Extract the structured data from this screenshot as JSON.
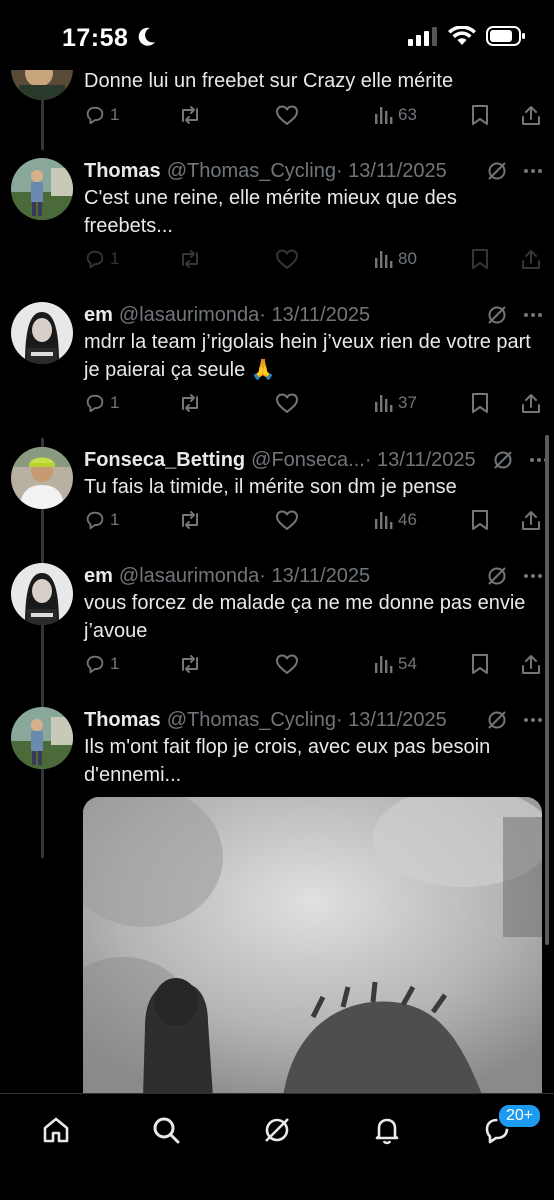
{
  "status_bar": {
    "time": "17:58"
  },
  "partial_tweet": {
    "text": "Donne lui un freebet sur Crazy elle mérite",
    "replies": "1",
    "views": "63"
  },
  "tweets": [
    {
      "name": "Thomas",
      "handle": "@Thomas_Cycling",
      "date": "· 13/11/2025",
      "text": "C'est une reine, elle mérite mieux que des freebets...",
      "replies": "1",
      "views": "80"
    },
    {
      "name": "em",
      "handle": "@lasaurimonda",
      "date": "· 13/11/2025",
      "text": "mdrr la team j’rigolais hein j’veux rien de votre part je paierai ça seule 🙏",
      "replies": "1",
      "views": "37"
    },
    {
      "name": "Fonseca_Betting",
      "handle": "@Fonseca...",
      "date": "· 13/11/2025",
      "text": "Tu fais la timide, il mérite son dm je pense",
      "replies": "1",
      "views": "46"
    },
    {
      "name": "em",
      "handle": "@lasaurimonda",
      "date": "· 13/11/2025",
      "text": "vous forcez de malade ça ne me donne pas envie j’avoue",
      "replies": "1",
      "views": "54"
    },
    {
      "name": "Thomas",
      "handle": "@Thomas_Cycling",
      "date": "· 13/11/2025",
      "text": "Ils m'ont fait flop je crois, avec eux pas besoin d'ennemi..."
    }
  ],
  "bottom_nav": {
    "badge": "20+",
    "icons": [
      "home-icon",
      "search-icon",
      "grok-icon",
      "notifications-icon",
      "messages-icon"
    ]
  },
  "colors": {
    "background": "#000000",
    "text": "#e7e9ea",
    "muted": "#71767b",
    "accent": "#1d9bf0"
  }
}
